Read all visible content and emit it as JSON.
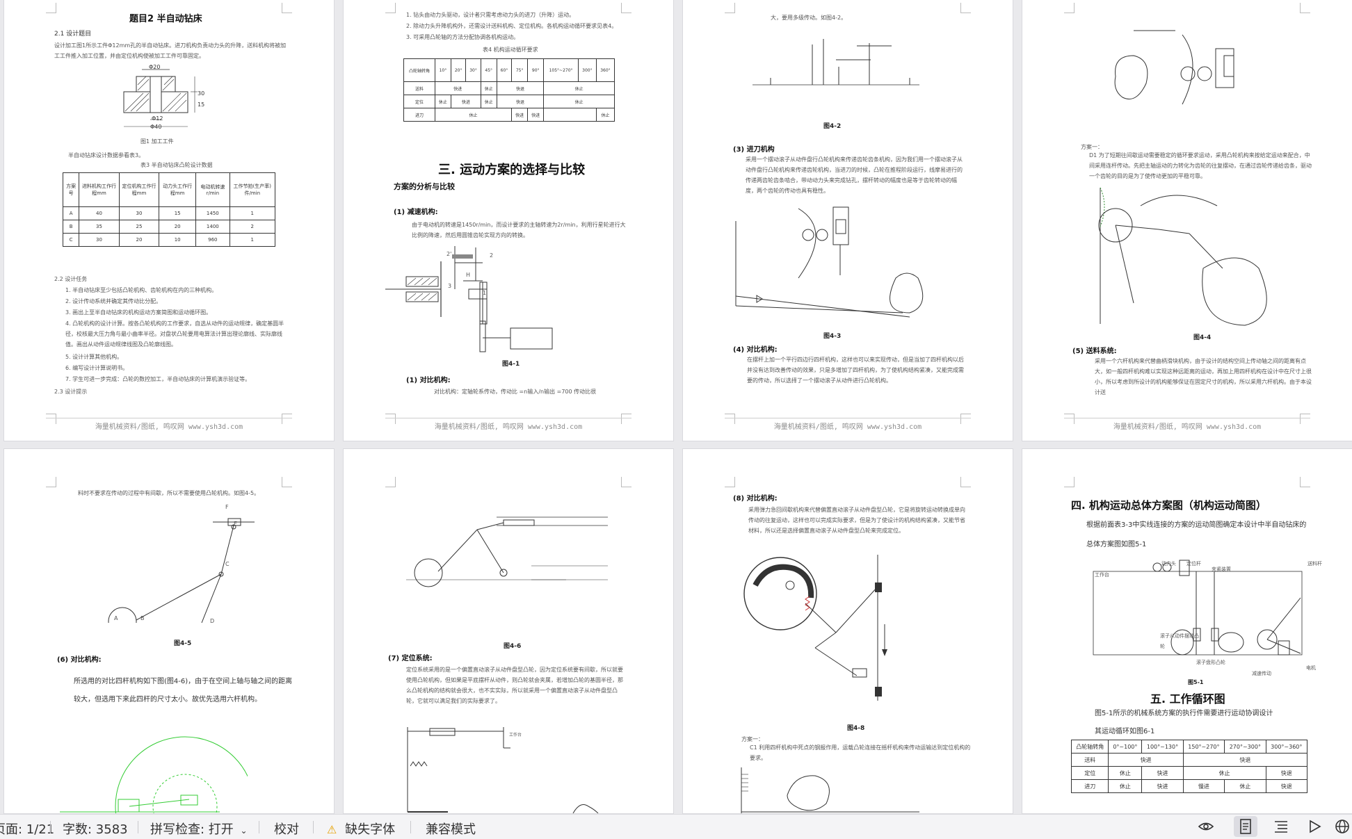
{
  "watermark": "海量机械资料/图纸, 鸣叹网 www.ysh3d.com",
  "page1": {
    "title": "题目2  半自动钻床",
    "s21": "2.1 设计题目",
    "p21": "设计加工图1所示工件Φ12mm孔的半自动钻床。进刀机构负责动力头的升降，送料机构将被加工工件推入加工位置，并由定位机构使被加工工件可靠固定。",
    "dim_top": "Φ20",
    "dim_mid": "Φ12",
    "dim_bot": "Φ40",
    "dim_h1": "30",
    "dim_h2": "15",
    "fig1": "图1 加工工件",
    "note": "半自动钻床设计数据参看表3。",
    "table_title": "表3  半自动钻床凸轮设计数据",
    "table_header": [
      "方案号",
      "进料机构工作行程mm",
      "定位机构工作行程mm",
      "动力头工作行程mm",
      "电动机转速r/min",
      "工作节拍(生产率)件/min"
    ],
    "table_rows": [
      [
        "A",
        "40",
        "30",
        "15",
        "1450",
        "1"
      ],
      [
        "B",
        "35",
        "25",
        "20",
        "1400",
        "2"
      ],
      [
        "C",
        "30",
        "20",
        "10",
        "960",
        "1"
      ]
    ],
    "s22": "2.2 设计任务",
    "tasks": [
      "1. 半自动钻床至少包括凸轮机构、齿轮机构在内的三种机构。",
      "2. 设计传动系统并确定其传动比分配。",
      "3. 画出上至半自动钻床的机构运动方案简图和运动循环图。",
      "4. 凸轮机构的设计计算。按各凸轮机构的工作要求，自选从动件的运动规律，确定基圆半径，校核最大压力角与最小曲率半径。对盘状凸轮要用电算法计算出理论廓线、实际廓线值。画出从动件运动规律线图及凸轮廓线图。",
      "5. 设计计算其他机构。",
      "6. 编写设计计算说明书。",
      "7. 学生可进一步完成：凸轮的数控加工，半自动钻床的计算机演示验证等。"
    ],
    "s23": "2.3 设计提示"
  },
  "page2": {
    "lines": [
      "1. 钻头由动力头驱动，设计者只需考虑动力头的进刀（升降）运动。",
      "2. 除动力头升降机构外，还需设计送料机构、定位机构。各机构运动循环要求见表4。",
      "3. 可采用凸轮轴的方法分配协调各机构运动。"
    ],
    "table_title": "表4  机构运动循环要求",
    "table_rows": [
      [
        "凸轮轴转角",
        "10°",
        "20°",
        "30°",
        "45°",
        "60°",
        "75°",
        "90°",
        "105°~270°",
        "300°",
        "360°"
      ],
      [
        "送料",
        "快进",
        "",
        "休止",
        "",
        "快退",
        "",
        "",
        "休止",
        "",
        ""
      ],
      [
        "定位",
        "休止",
        "快进",
        "",
        "休止",
        "",
        "快退",
        "",
        "休止",
        "",
        ""
      ],
      [
        "进刀",
        "休止",
        "",
        "",
        "",
        "快进",
        "",
        "快进",
        "",
        "快退",
        "休止"
      ]
    ],
    "heading": "三. 运动方案的选择与比较",
    "sub": "方案的分析与比较",
    "h1": "(1) 减速机构:",
    "p1": "由于电动机的转速是1450r/min，而设计要求的主轴转速为2r/min，利用行星轮进行大比例的降速，然后用圆锥齿轮实现方向的转换。",
    "labels": [
      "2'",
      "2",
      "H",
      "3",
      "1"
    ],
    "fig": "图4-1",
    "h2": "(1) 对比机构:",
    "p2": "对比机构：定轴轮系传动，传动比 =n输入/n输出 =700 传动比很"
  },
  "page3": {
    "line0": "大，要用多级传动。如图4-2。",
    "fig42": "图4-2",
    "h3": "(3) 进刀机构",
    "p3": "采用一个摆动滚子从动件盘行凸轮机构来传递齿轮齿条机构，因为我们用一个摆动滚子从动件盘行凸轮机构来传递齿轮机构，当进刀的时候，凸轮在推程阶段运行，线摩易进行的传递两齿轮齿条啮合，带动动力头来完成钻孔，摆杆转动的幅度也是等于齿轮转动的幅度，两个齿轮的传动也具有稳性。",
    "fig43": "图4-3",
    "h4": "(4) 对比机构:",
    "p4": "在摆杆上加一个平行四边行四杆机构，这样也可以来实现传动，但是当加了四杆机构以后并没有达到改善传动的效果，只是多增加了四杆机构，为了使机构结构紧凑，又能完成需要的传动，所以选择了一个摆动滚子从动件进行凸轮机构。"
  },
  "page4": {
    "b1": "方案一：",
    "b2": "D1 为了短期往间歇运动需要稳定的循环要求运动，采用凸轮机构来按给定运动来配合，中间采用连杆传动。先把主轴运动的力转化为齿轮的往复摆动，在通过齿轮传递给齿条，驱动一个齿轮的目的是为了使传动更加的平稳可靠。",
    "fig44": "图4-4",
    "h5": "(5) 送料系统:",
    "p5": "采用一个六杆机构来代替曲柄滑块机构，由于设计的结构空间上传动轴之间的距离有点大，如一般四杆机构难以实现这种远距离的运动，再加上用四杆机构在设计中在尺寸上很小，所以考虑到所设计的机构能够保证在固定尺寸的机构，所以采用六杆机构。由于本设计送"
  },
  "page5": {
    "line0": "料时不要求在传动的过程中有间歇，所以不需要使用凸轮机构。如图4-5。",
    "labels": [
      "F",
      "E",
      "C",
      "A",
      "B",
      "D"
    ],
    "fig45": "图4-5",
    "h6": "(6) 对比机构:",
    "p6": "所选用的对比四杆机构如下图(图4-6)，由于在空间上轴与轴之间的距离较大，但选用下来此四杆的尺寸太小。故优先选用六杆机构。"
  },
  "page6": {
    "fig46": "图4-6",
    "h7": "(7) 定位系统:",
    "p7": "定位系统采用的是一个偏置直动滚子从动件盘型凸轮，因为定位系统要有间歇，所以就要使用凸轮机构，但如果是平底摆杆从动件，则凸轮就会夹属，若增加凸轮的基圆半径，那么凸轮机构的结构就会很大，也不实实际，所以就采用一个偏置直动滚子从动件盘型凸轮，它就可以满足我们的实际要求了。",
    "lbl": "工作台"
  },
  "page7": {
    "h8": "(8) 对比机构:",
    "p8": "采用弹力急回间歇机构来代替偏置直动滚子从动件盘型凸轮，它是将旋转运动转换成单向传动的往复运动，这样也可以完成实际要求，但是为了使设计的机构结构紧凑，又能节省材料，所以还是选择偏置直动滚子从动件盘型凸轮来完成定位。",
    "fig48": "图4-8",
    "b1": "方案一：",
    "b2": "C1 利用四杆机构中死点的钢报作用，运载凸轮连接在摇杆机构来传动运输达到定位机构的要求。"
  },
  "page8": {
    "h4": "四. 机构运动总体方案图（机构运动简图）",
    "p": "根据前面表3-3中实线连接的方案的运动简图确定本设计中半自动钻床的总体方案图如图5-1",
    "labels": {
      "power": "动力头",
      "pos": "定位杆",
      "clamp": "夹紧装置",
      "feed": "送料杆",
      "table": "工作台",
      "roller": "滚子从动件摆动凸轮",
      "disc": "滚子盘形凸轮",
      "gear": "减速传动",
      "motor": "电机"
    },
    "fig51": "图5-1",
    "h5": "五. 工作循环图",
    "p5a": "图5-1所示的机械系统方案的执行件需要进行运动协调设计",
    "p5b": "其运动循环如图6-1",
    "table_rows": [
      [
        "凸轮轴转角",
        "0°~100°",
        "100°~130°",
        "150°~270°",
        "270°~300°",
        "300°~360°"
      ],
      [
        "送料",
        "快进",
        "",
        "快退",
        "",
        ""
      ],
      [
        "定位",
        "休止",
        "快进",
        "休止",
        "",
        "快退"
      ],
      [
        "进刀",
        "休止",
        "快进",
        "慢进",
        "休止",
        "快退"
      ]
    ]
  },
  "status": {
    "page": "页面: 1/21",
    "words": "字数: 3583",
    "spell": "拼写检查: 打开",
    "proof": "校对",
    "font": "缺失字体",
    "compat": "兼容模式"
  }
}
